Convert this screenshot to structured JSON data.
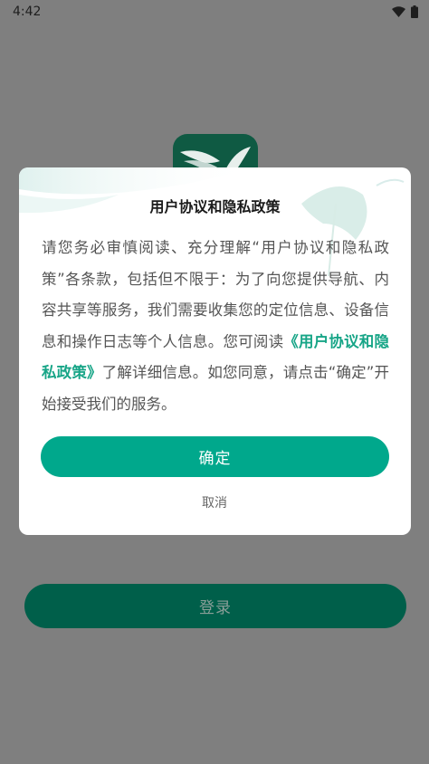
{
  "status_bar": {
    "time": "4:42",
    "icons": [
      "wifi-icon",
      "battery-icon"
    ]
  },
  "app": {
    "logo_icon": "app-logo-icon",
    "login_label": "登录"
  },
  "dialog": {
    "title": "用户协议和隐私政策",
    "body_intro": "请您务必审慎阅读、充分理解“用户协议和隐私政策”各条款，包括但不限于：为了向您提供导航、内容共享等服务，我们需要收集您的定位信息、设备信息和操作日志等个人信息。您可阅读",
    "policy_link": "《用户协议和隐私政策》",
    "body_outro": "了解详细信息。如您同意，请点击“确定”开始接受我们的服务。",
    "confirm_label": "确定",
    "cancel_label": "取消"
  },
  "colors": {
    "overlay": "#7f7f7f",
    "accent": "#00a88c",
    "link": "#17a587",
    "login_button": "#005f4a"
  }
}
